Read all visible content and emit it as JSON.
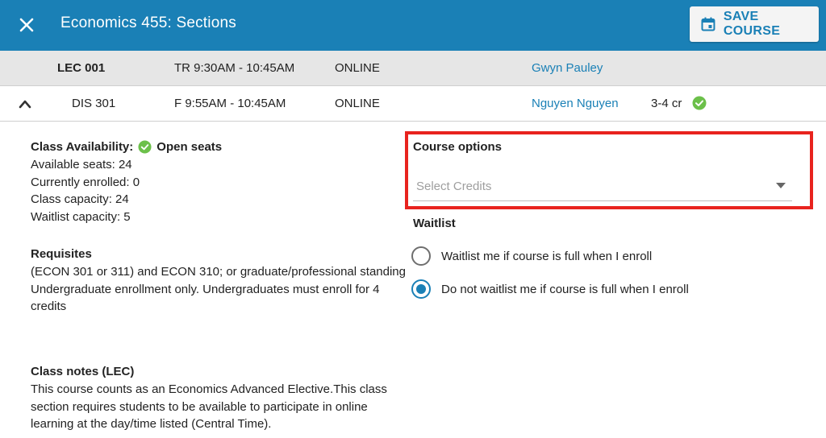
{
  "header": {
    "title": "Economics 455: Sections",
    "save_label": "SAVE COURSE",
    "bg_color": "#1a80b6"
  },
  "sections": {
    "lecture": {
      "name": "LEC 001",
      "time": "TR 9:30AM - 10:45AM",
      "location": "ONLINE",
      "instructor": "Gwyn Pauley"
    },
    "discussion": {
      "name": "DIS 301",
      "time": "F 9:55AM - 10:45AM",
      "location": "ONLINE",
      "instructor": "Nguyen Nguyen",
      "credits": "3-4 cr"
    }
  },
  "availability": {
    "heading": "Class Availability:",
    "status": "Open seats",
    "available_seats": "Available seats: 24",
    "enrolled": "Currently enrolled: 0",
    "capacity": "Class capacity: 24",
    "waitlist_capacity": "Waitlist capacity: 5"
  },
  "requisites": {
    "heading": "Requisites",
    "line1": "(ECON 301 or 311) and ECON 310; or graduate/professional standing",
    "line2": "Undergraduate enrollment only. Undergraduates must enroll for 4 credits"
  },
  "class_notes": {
    "heading": "Class notes (LEC)",
    "text": "This course counts as an Economics Advanced Elective.This class section requires students to be available to participate in online learning at the day/time listed (Central Time)."
  },
  "course_options": {
    "label": "Course options",
    "credits_placeholder": "Select Credits",
    "highlight_color": "#e8231e"
  },
  "waitlist": {
    "label": "Waitlist",
    "options": [
      {
        "label": "Waitlist me if course is full when I enroll",
        "selected": false
      },
      {
        "label": "Do not waitlist me if course is full when I enroll",
        "selected": true
      }
    ]
  },
  "icons": {
    "close": "close-icon",
    "calendar": "calendar-icon",
    "chevron": "chevron-up-icon",
    "check": "check-circle-icon",
    "dropdown": "caret-down-icon"
  },
  "colors": {
    "accent": "#1a80b6",
    "success": "#6cc04a"
  }
}
